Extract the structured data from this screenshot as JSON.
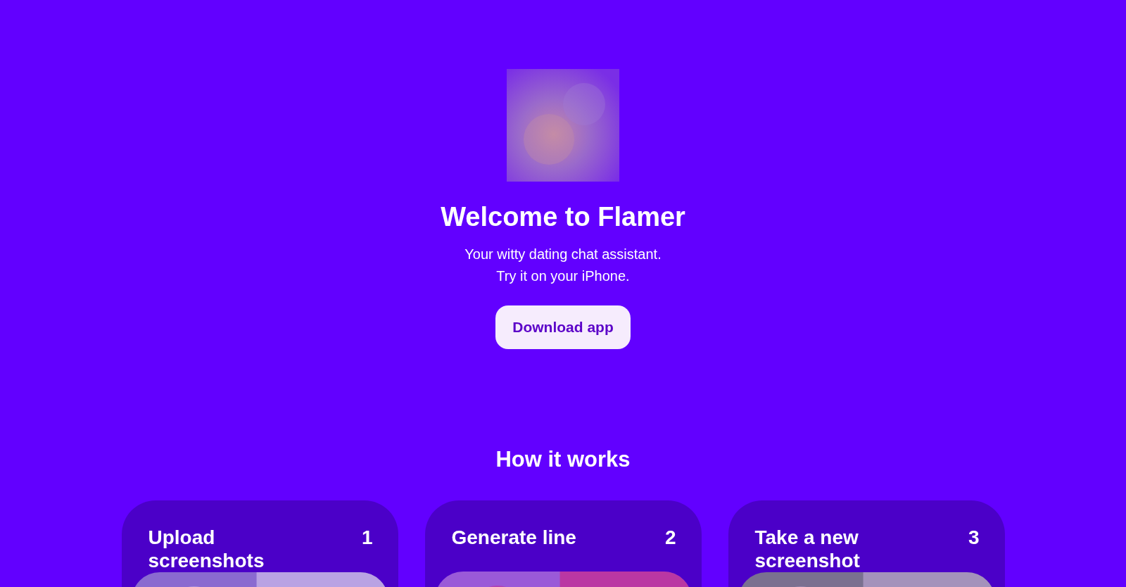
{
  "hero": {
    "logo": {
      "kind": "picture"
    },
    "title": "Welcome to Flamer",
    "subtitle_lines": [
      "Your witty dating chat assistant.",
      "Try it on your iPhone."
    ],
    "button": "Download app"
  },
  "how_it_works": {
    "heading": "How it works",
    "steps": [
      {
        "title": "Upload screenshots",
        "number": "1",
        "picture": {
          "kind": "picture"
        }
      },
      {
        "title": "Generate line",
        "number": "2",
        "picture": {
          "kind": "picture"
        }
      },
      {
        "title": "Take a new screenshot",
        "number": "3",
        "picture": {
          "kind": "picture"
        }
      }
    ]
  }
}
